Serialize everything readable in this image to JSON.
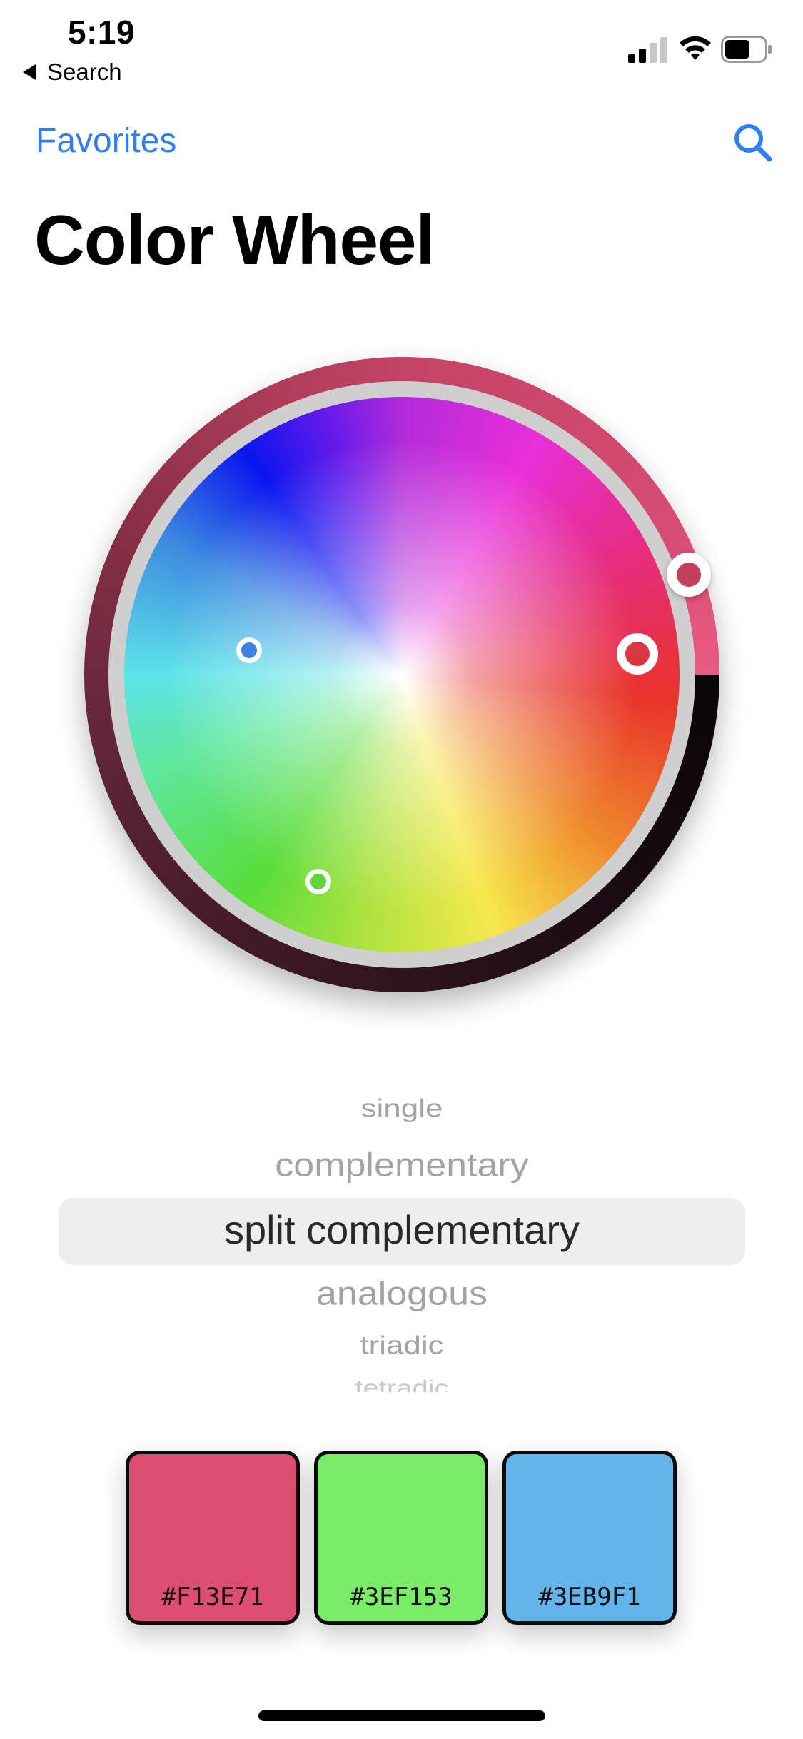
{
  "status_bar": {
    "time": "5:19",
    "back_label": "Search",
    "icons": [
      "cellular-signal-icon",
      "wifi-icon",
      "battery-icon"
    ]
  },
  "nav": {
    "favorites_label": "Favorites",
    "search_icon": "search-icon"
  },
  "page": {
    "title": "Color Wheel"
  },
  "color_wheel": {
    "handles": [
      {
        "role": "primary",
        "color": "#F13E71"
      },
      {
        "role": "secondary",
        "color": "#3EB9F1"
      },
      {
        "role": "secondary",
        "color": "#3EF153"
      }
    ]
  },
  "harmony_picker": {
    "options": [
      "single",
      "complementary",
      "split complementary",
      "analogous",
      "triadic",
      "tetradic"
    ],
    "selected": "split complementary"
  },
  "swatches": [
    {
      "hex": "#F13E71",
      "color": "#de4e72"
    },
    {
      "hex": "#3EF153",
      "color": "#7aec69"
    },
    {
      "hex": "#3EB9F1",
      "color": "#63b4ea"
    }
  ],
  "colors": {
    "accent": "#2f7ef2"
  }
}
